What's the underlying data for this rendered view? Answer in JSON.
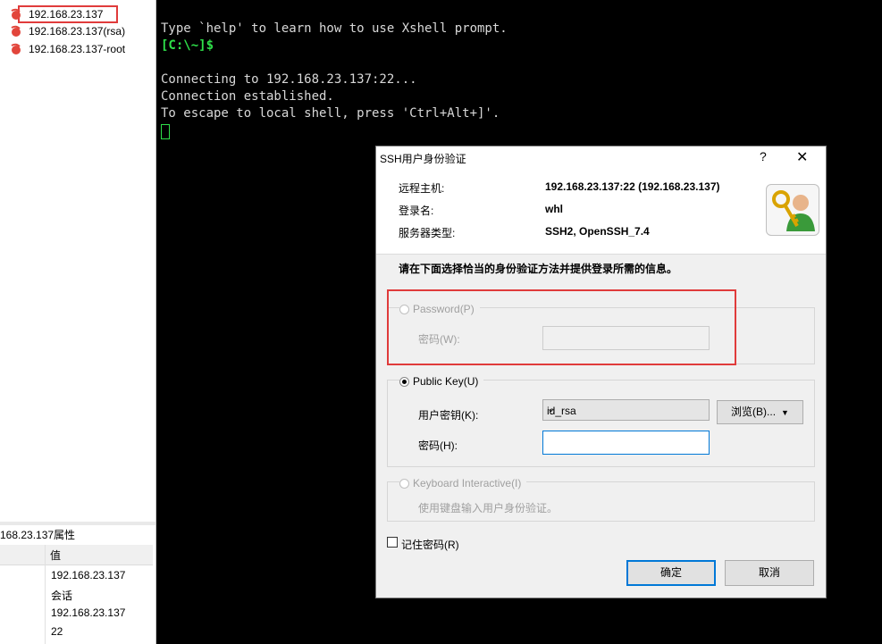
{
  "session_tree": {
    "items": [
      {
        "label": "192.168.23.137"
      },
      {
        "label": "192.168.23.137(rsa)"
      },
      {
        "label": "192.168.23.137-root"
      }
    ]
  },
  "properties": {
    "title": "168.23.137属性",
    "column_value": "值",
    "rows": [
      "192.168.23.137",
      "会话",
      "192.168.23.137",
      "22"
    ]
  },
  "terminal": {
    "lines": [
      "Type `help' to learn how to use Xshell prompt.",
      "[C:\\~]$",
      "",
      "Connecting to 192.168.23.137:22...",
      "Connection established.",
      "To escape to local shell, press 'Ctrl+Alt+]'."
    ]
  },
  "dialog": {
    "title": "SSH用户身份验证",
    "help": "?",
    "close": "✕",
    "remote_host_label": "远程主机:",
    "remote_host_value": "192.168.23.137:22 (192.168.23.137)",
    "login_label": "登录名:",
    "login_value": "whl",
    "server_type_label": "服务器类型:",
    "server_type_value": "SSH2, OpenSSH_7.4",
    "instruction": "请在下面选择恰当的身份验证方法并提供登录所需的信息。",
    "password_option": "Password(P)",
    "password_field_label": "密码(W):",
    "pubkey_option": "Public Key(U)",
    "user_key_label": "用户密钥(K):",
    "user_key_value": "id_rsa",
    "browse_label": "浏览(B)...",
    "passphrase_label": "密码(H):",
    "keyboard_option": "Keyboard Interactive(I)",
    "keyboard_desc": "使用键盘输入用户身份验证。",
    "remember_label": "记住密码(R)",
    "ok_label": "确定",
    "cancel_label": "取消"
  },
  "colors": {
    "terminal_bg": "#000000",
    "prompt_green": "#2fe04a",
    "highlight_red": "#e03b3b",
    "focus_blue": "#0078d7"
  }
}
